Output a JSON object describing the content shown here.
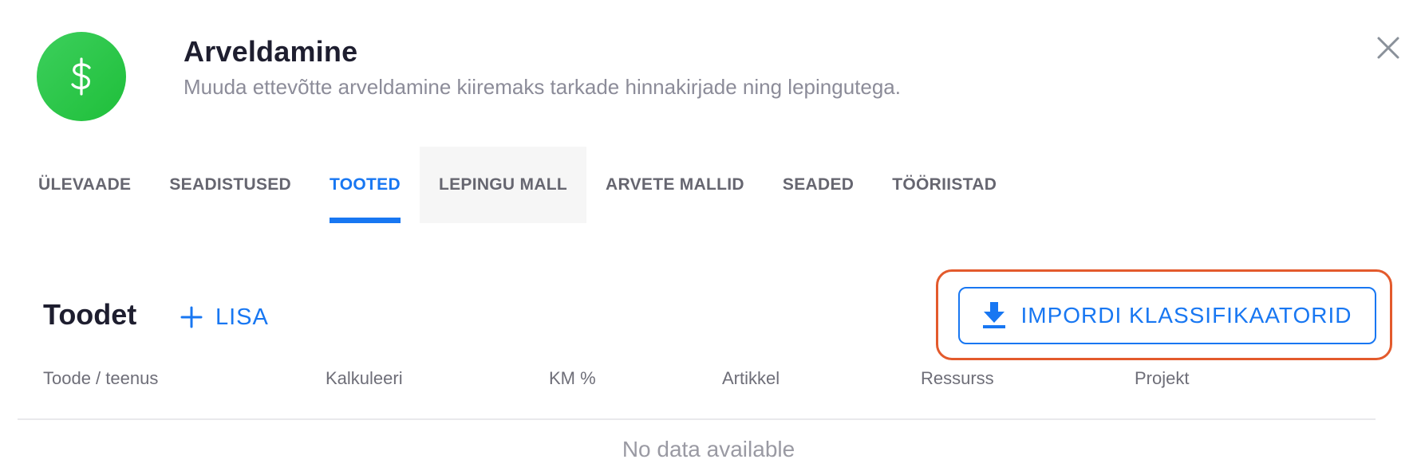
{
  "header": {
    "icon": "dollar-icon",
    "title": "Arveldamine",
    "subtitle": "Muuda ettevõtte arveldamine kiiremaks tarkade hinnakirjade ning lepingutega."
  },
  "close": {
    "icon": "close-icon"
  },
  "tabs": [
    {
      "label": "ÜLEVAADE",
      "active": false
    },
    {
      "label": "SEADISTUSED",
      "active": false
    },
    {
      "label": "TOOTED",
      "active": true
    },
    {
      "label": "LEPINGU MALL",
      "active": false,
      "hovered": true
    },
    {
      "label": "ARVETE MALLID",
      "active": false
    },
    {
      "label": "SEADED",
      "active": false
    },
    {
      "label": "TÖÖRIISTAD",
      "active": false
    }
  ],
  "products": {
    "title": "Toodet",
    "add_label": "LISA",
    "add_icon": "plus-icon",
    "import_label": "IMPORDI KLASSIFIKAATORID",
    "import_icon": "download-icon",
    "columns": [
      "Toode / teenus",
      "Kalkuleeri",
      "KM %",
      "Artikkel",
      "Ressurss",
      "Projekt"
    ],
    "empty_text": "No data available"
  },
  "colors": {
    "accent": "#1877f2",
    "brand_green": "#22c142",
    "highlight": "#e35a2c"
  }
}
